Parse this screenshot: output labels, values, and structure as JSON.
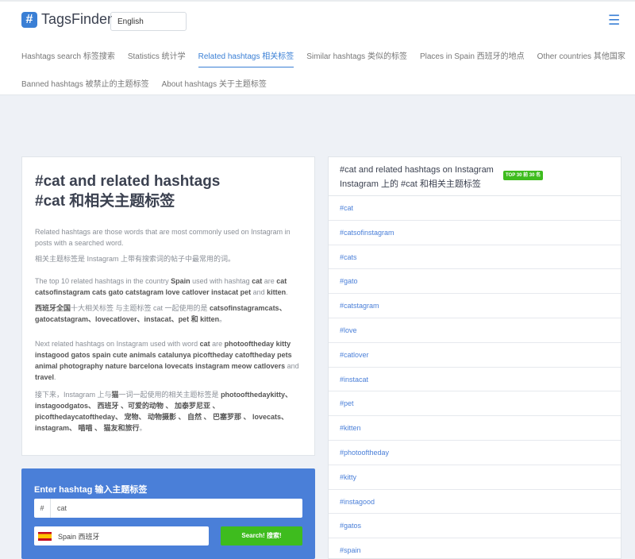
{
  "header": {
    "logo_mark": "#",
    "logo_text": "TagsFinder",
    "language": "English",
    "menu_icon": "☰"
  },
  "nav": {
    "row1": [
      {
        "label": "Hashtags search  标签搜索",
        "active": false
      },
      {
        "label": "Statistics  统计学",
        "active": false
      },
      {
        "label": "Related hashtags  相关标签",
        "active": true
      },
      {
        "label": "Similar hashtags  类似的标签",
        "active": false
      },
      {
        "label": "Places in Spain  西班牙的地点",
        "active": false
      },
      {
        "label": "Other countries  其他国家",
        "active": false
      }
    ],
    "row2": [
      {
        "label": "Banned hashtags  被禁止的主题标签",
        "active": false
      },
      {
        "label": "About hashtags  关于主题标签",
        "active": false
      }
    ]
  },
  "main": {
    "title_en": "#cat and related hashtags",
    "title_cn": "#cat 和相关主题标签",
    "p1": "Related hashtags are those words that are most commonly used on Instagram in posts with a searched word.",
    "p1_cn": "相关主题标签是 Instagram 上带有搜索词的帖子中最常用的词。",
    "p2_pre": "The top 10 related hashtags in the country ",
    "p2_country": "Spain",
    "p2_mid": " used with hashtag ",
    "p2_tag": "cat",
    "p2_post": " are ",
    "p2_list": "cat catsofinstagram cats gato catstagram love catlover instacat pet",
    "p2_and": " and ",
    "p2_last": "kitten",
    "p2_end": ".",
    "p2_cn_bold1": "西班牙全国",
    "p2_cn_text": "十大相关标签 与主题标签 cat 一起使用的是 ",
    "p2_cn_list": "catsofinstagramcats、gatocatstagram、lovecatlover、instacat、pet 和 kitten",
    "p2_cn_end": "。",
    "p3_pre": "Next related hashtags on Instagram used with word ",
    "p3_tag": "cat",
    "p3_post": " are ",
    "p3_list": "photooftheday kitty instagood gatos spain cute animals catalunya picoftheday catoftheday pets animal photography nature barcelona lovecats instagram meow catlovers",
    "p3_and": " and ",
    "p3_last": "travel",
    "p3_end": ".",
    "p3_cn_pre": "接下来，Instagram 上与",
    "p3_cn_tag": "猫",
    "p3_cn_mid": "一词一起使用的相关主题标签是 ",
    "p3_cn_list": "photooftheday​kitty、instagoodgatos、 西班牙 、可爱的动物 、 加泰罗尼亚 、 picofthedaycatoftheday、  宠物、  动物摄影 、 自然 、 巴塞罗那 、 lovecats、instagram、 喵喵 、 猫友和旅行",
    "p3_cn_end": "。"
  },
  "search": {
    "title": "Enter hashtag  输入主题标签",
    "prefix": "#",
    "value": "cat",
    "country": "Spain  西班牙",
    "button": "Search!  搜索!"
  },
  "related": {
    "head_en": "#cat and related hashtags on Instagram",
    "head_cn": "Instagram 上的 #cat 和相关主题标签",
    "badge": "TOP 30  前 30 名",
    "tags": [
      "#cat",
      "#catsofinstagram",
      "#cats",
      "#gato",
      "#catstagram",
      "#love",
      "#catlover",
      "#instacat",
      "#pet",
      "#kitten",
      "#photooftheday",
      "#kitty",
      "#instagood",
      "#gatos",
      "#spain"
    ]
  }
}
